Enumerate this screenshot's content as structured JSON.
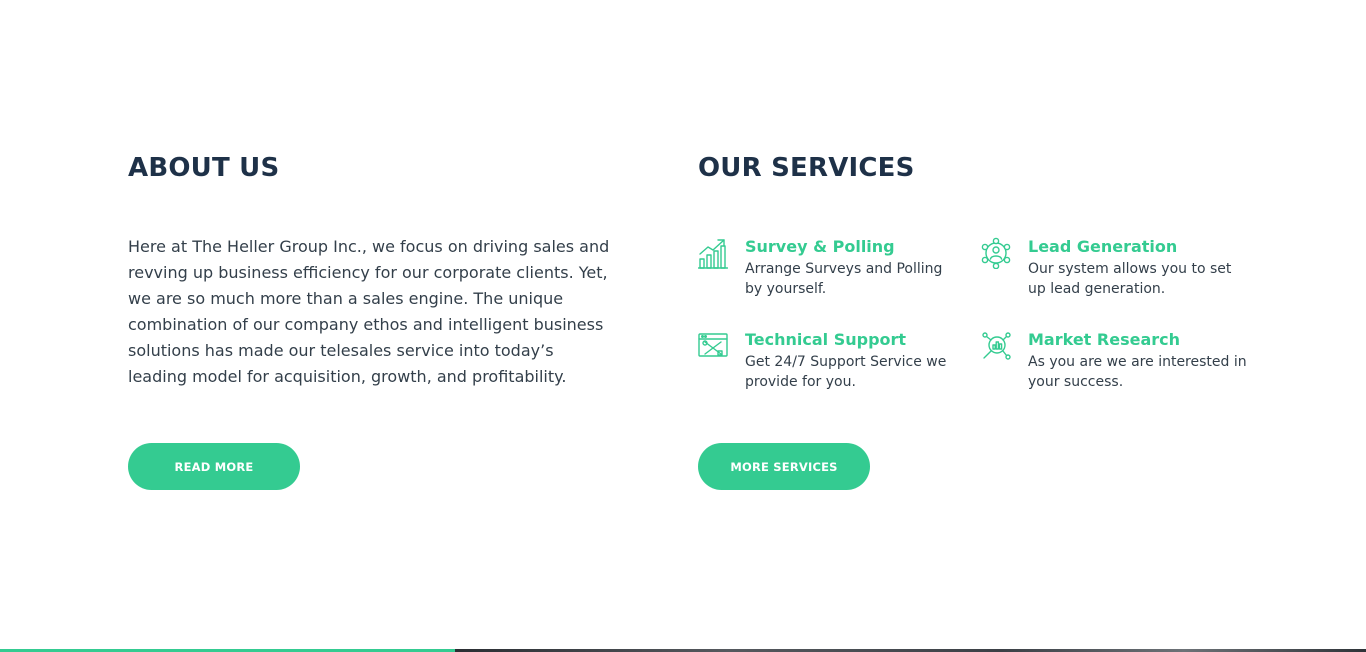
{
  "about": {
    "title": "ABOUT US",
    "body_lines": [
      "Here at The Heller Group Inc., we focus on driving sales and",
      "revving up business efficiency for our corporate clients. Yet,",
      "we are so much more than a sales engine.  The unique",
      "combination of our company ethos and intelligent business",
      "solutions has made our telesales service into today’s",
      "leading model for acquisition, growth, and profitability."
    ],
    "button_label": "READ MORE"
  },
  "services": {
    "title": "OUR SERVICES",
    "items": [
      {
        "icon": "chart-growth-icon",
        "title": "Survey & Polling",
        "desc_lines": [
          "Arrange Surveys and Polling",
          "by yourself."
        ]
      },
      {
        "icon": "network-people-icon",
        "title": "Lead Generation",
        "desc_lines": [
          "Our system allows you to set",
          "up lead generation."
        ]
      },
      {
        "icon": "tools-support-icon",
        "title": "Technical Support",
        "desc_lines": [
          "Get 24/7 Support Service we",
          "provide for you."
        ]
      },
      {
        "icon": "market-research-icon",
        "title": "Market Research",
        "desc_lines": [
          "As you are we are interested in",
          "your success."
        ]
      }
    ],
    "button_label": "MORE SERVICES"
  },
  "colors": {
    "accent": "#34cb91",
    "heading": "#1e3148",
    "body_text": "#333f4a",
    "background": "#ffffff"
  }
}
